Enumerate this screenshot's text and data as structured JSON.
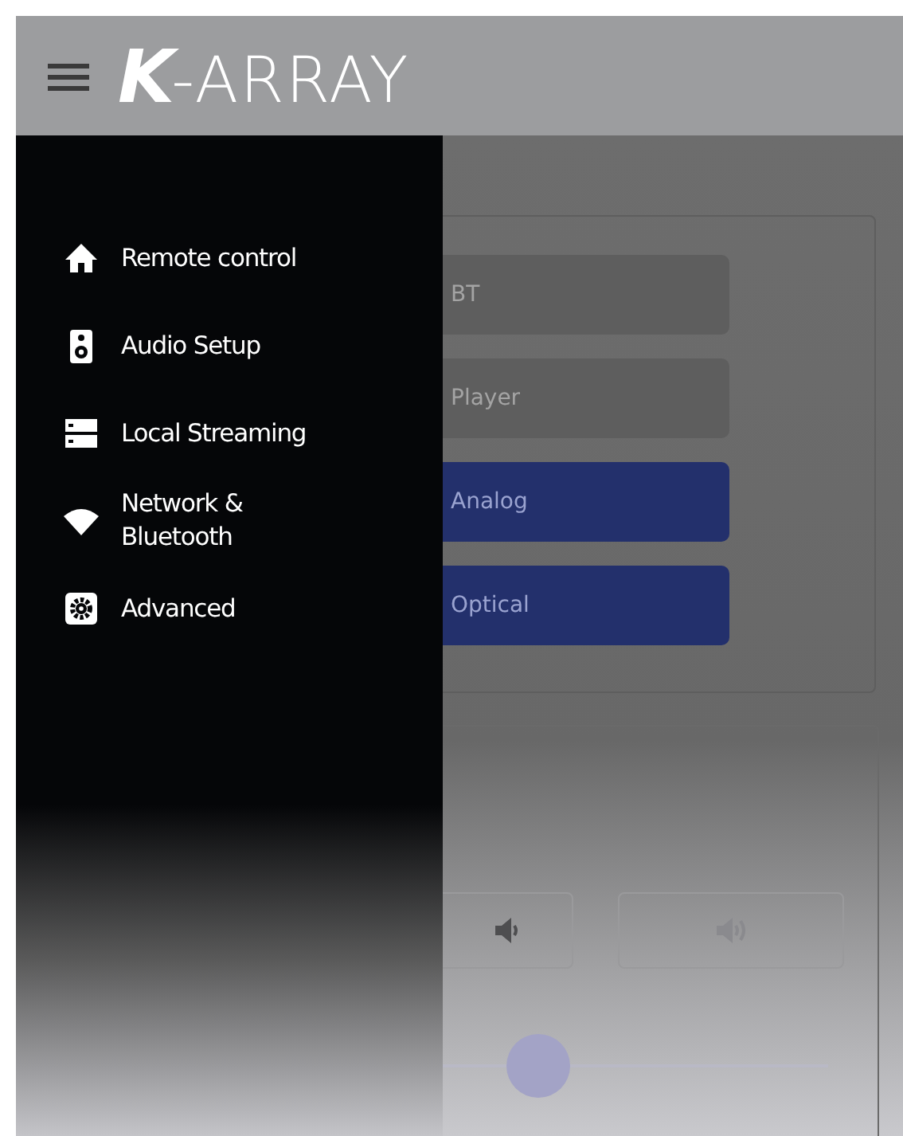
{
  "header": {
    "logo": "**K**-ARRAY"
  },
  "sources": [
    {
      "label": "BT",
      "selected": false
    },
    {
      "label": "Player",
      "selected": false
    },
    {
      "label": "Analog",
      "selected": true
    },
    {
      "label": "Optical",
      "selected": true
    }
  ],
  "volume": {
    "level": 0.62
  },
  "drawer": {
    "items": [
      {
        "kind": "home",
        "label": "Remote control"
      },
      {
        "kind": "speaker",
        "label": "Audio Setup"
      },
      {
        "kind": "server",
        "label": "Local Streaming"
      },
      {
        "kind": "wifi",
        "label": "Network & Bluetooth"
      },
      {
        "kind": "gear",
        "label": "Advanced"
      }
    ]
  }
}
